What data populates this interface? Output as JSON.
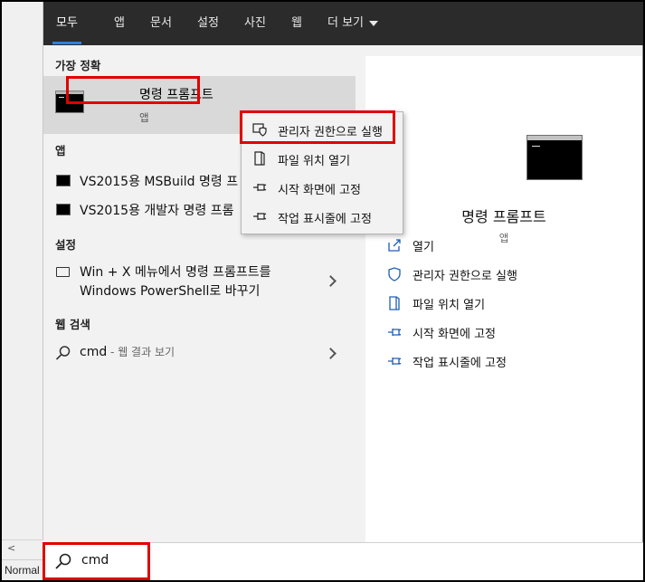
{
  "tabs": [
    {
      "label": "모두",
      "active": true
    },
    {
      "label": "앱"
    },
    {
      "label": "문서"
    },
    {
      "label": "설정"
    },
    {
      "label": "사진"
    },
    {
      "label": "웹"
    },
    {
      "label": "더 보기"
    }
  ],
  "left": {
    "best_match_title": "가장 정확",
    "best_match": {
      "name": "명령 프롬프트",
      "type": "앱"
    },
    "apps_title": "앱",
    "apps": [
      {
        "name": "VS2015용 MSBuild 명령 프"
      },
      {
        "name": "VS2015용 개발자 명령 프롬"
      }
    ],
    "settings_title": "설정",
    "setting": {
      "line1": "Win + X 메뉴에서 명령 프롬프트를",
      "line2": "Windows PowerShell로 바꾸기"
    },
    "web_title": "웹 검색",
    "web": {
      "query": "cmd",
      "suffix": " - 웹 결과 보기"
    }
  },
  "context_menu": [
    {
      "label": "관리자 권한으로 실행",
      "icon": "shield-icon"
    },
    {
      "label": "파일 위치 열기",
      "icon": "folder-icon"
    },
    {
      "label": "시작 화면에 고정",
      "icon": "pin-icon"
    },
    {
      "label": "작업 표시줄에 고정",
      "icon": "pin-icon"
    }
  ],
  "right": {
    "title": "명령 프롬프트",
    "subtitle": "앱",
    "actions": [
      {
        "label": "열기",
        "icon": "open-icon"
      },
      {
        "label": "관리자 권한으로 실행",
        "icon": "shield-icon"
      },
      {
        "label": "파일 위치 열기",
        "icon": "folder-icon"
      },
      {
        "label": "시작 화면에 고정",
        "icon": "pin-icon"
      },
      {
        "label": "작업 표시줄에 고정",
        "icon": "pin-icon"
      }
    ]
  },
  "search_box": {
    "value": "cmd"
  },
  "background_app": {
    "status": "Normal",
    "scroll_arrow": "<"
  },
  "colors": {
    "accent": "#2f7fe0",
    "highlight": "#e00000",
    "tabbar": "#2b2b2b"
  }
}
